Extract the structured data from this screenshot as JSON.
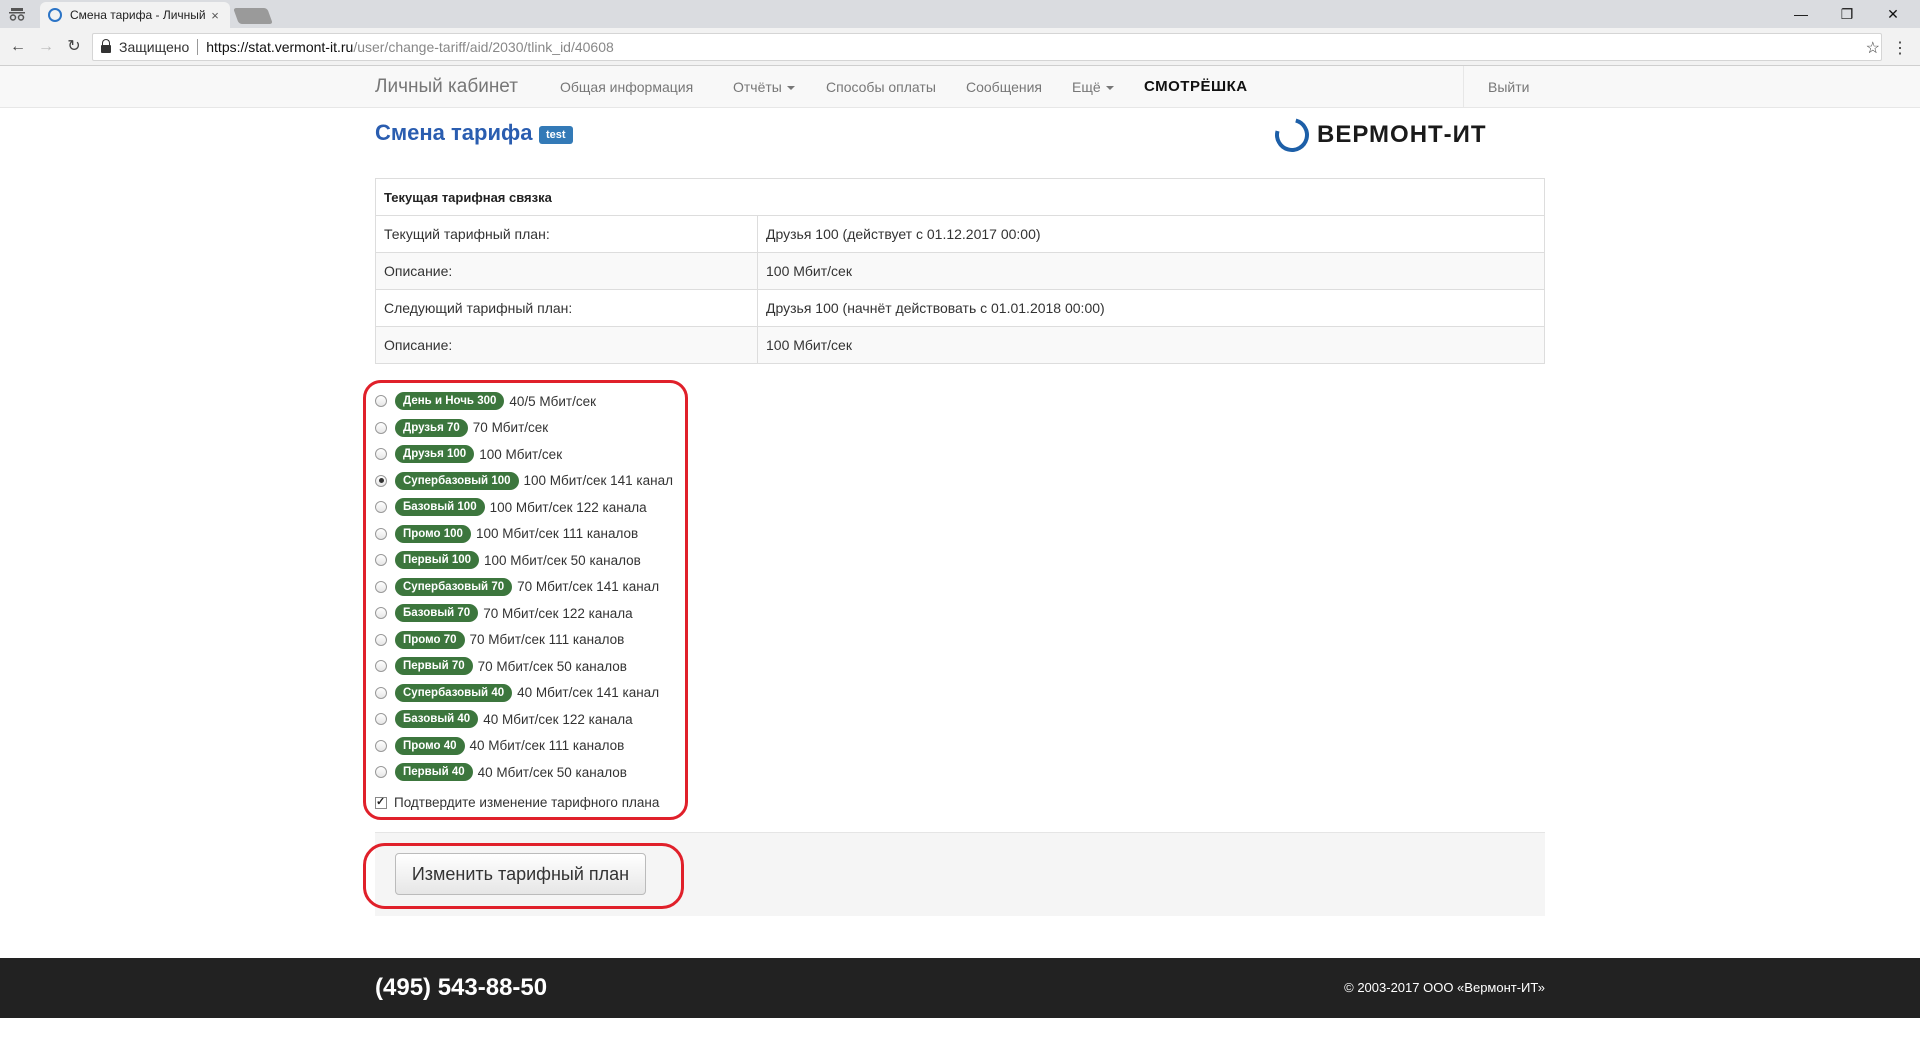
{
  "browser": {
    "tab_title": "Смена тарифа - Личный",
    "tab_close": "×",
    "secure_label": "Защищено",
    "url_host": "https://stat.vermont-it.ru",
    "url_path": "/user/change-tariff/aid/2030/tlink_id/40608",
    "controls": {
      "minimize": "—",
      "maximize": "❐",
      "close": "✕"
    },
    "nav": {
      "back": "←",
      "forward": "→",
      "reload": "↻",
      "star": "☆",
      "menu": "⋮"
    }
  },
  "navbar": {
    "brand": "Личный кабинет",
    "links": {
      "general": "Общая информация",
      "reports": "Отчёты",
      "payment": "Способы оплаты",
      "messages": "Сообщения",
      "more": "Ещё"
    },
    "smotreshka": "СМОТРЁШКА",
    "logout": "Выйти"
  },
  "page": {
    "title": "Смена тарифа",
    "badge": "test",
    "logo_text": "ВЕРМОНТ-ИТ"
  },
  "current": {
    "header": "Текущая тарифная связка",
    "rows": [
      {
        "label": "Текущий тарифный план:",
        "value": "Друзья 100 (действует с 01.12.2017 00:00)"
      },
      {
        "label": "Описание:",
        "value": "100 Мбит/сек"
      },
      {
        "label": "Следующий тарифный план:",
        "value": "Друзья 100 (начнёт действовать с 01.01.2018 00:00)"
      },
      {
        "label": "Описание:",
        "value": "100 Мбит/сек"
      }
    ]
  },
  "tariffs": [
    {
      "name": "День и Ночь 300",
      "desc": "40/5 Мбит/сек",
      "selected": false
    },
    {
      "name": "Друзья 70",
      "desc": "70 Мбит/сек",
      "selected": false
    },
    {
      "name": "Друзья 100",
      "desc": "100 Мбит/сек",
      "selected": false
    },
    {
      "name": "Супербазовый 100",
      "desc": "100 Мбит/сек 141 канал",
      "selected": true
    },
    {
      "name": "Базовый 100",
      "desc": "100 Мбит/сек 122 канала",
      "selected": false
    },
    {
      "name": "Промо 100",
      "desc": "100 Мбит/сек 111 каналов",
      "selected": false
    },
    {
      "name": "Первый 100",
      "desc": "100 Мбит/сек 50 каналов",
      "selected": false
    },
    {
      "name": "Супербазовый 70",
      "desc": "70 Мбит/сек 141 канал",
      "selected": false
    },
    {
      "name": "Базовый 70",
      "desc": "70 Мбит/сек 122 канала",
      "selected": false
    },
    {
      "name": "Промо 70",
      "desc": "70 Мбит/сек 111 каналов",
      "selected": false
    },
    {
      "name": "Первый 70",
      "desc": "70 Мбит/сек 50 каналов",
      "selected": false
    },
    {
      "name": "Супербазовый 40",
      "desc": "40 Мбит/сек 141 канал",
      "selected": false
    },
    {
      "name": "Базовый 40",
      "desc": "40 Мбит/сек 122 канала",
      "selected": false
    },
    {
      "name": "Промо 40",
      "desc": "40 Мбит/сек 111 каналов",
      "selected": false
    },
    {
      "name": "Первый 40",
      "desc": "40 Мбит/сек 50 каналов",
      "selected": false
    }
  ],
  "confirm": {
    "label": "Подтвердите изменение тарифного плана",
    "checked": true
  },
  "submit_label": "Изменить тарифный план",
  "footer": {
    "phone": "(495) 543-88-50",
    "copyright": "© 2003-2017 ООО «Вермонт-ИТ»"
  },
  "colors": {
    "tariff_badge": "#3c763d",
    "title_blue": "#2a5db0",
    "annotation_red": "#e0202a",
    "footer_bg": "#222222"
  }
}
